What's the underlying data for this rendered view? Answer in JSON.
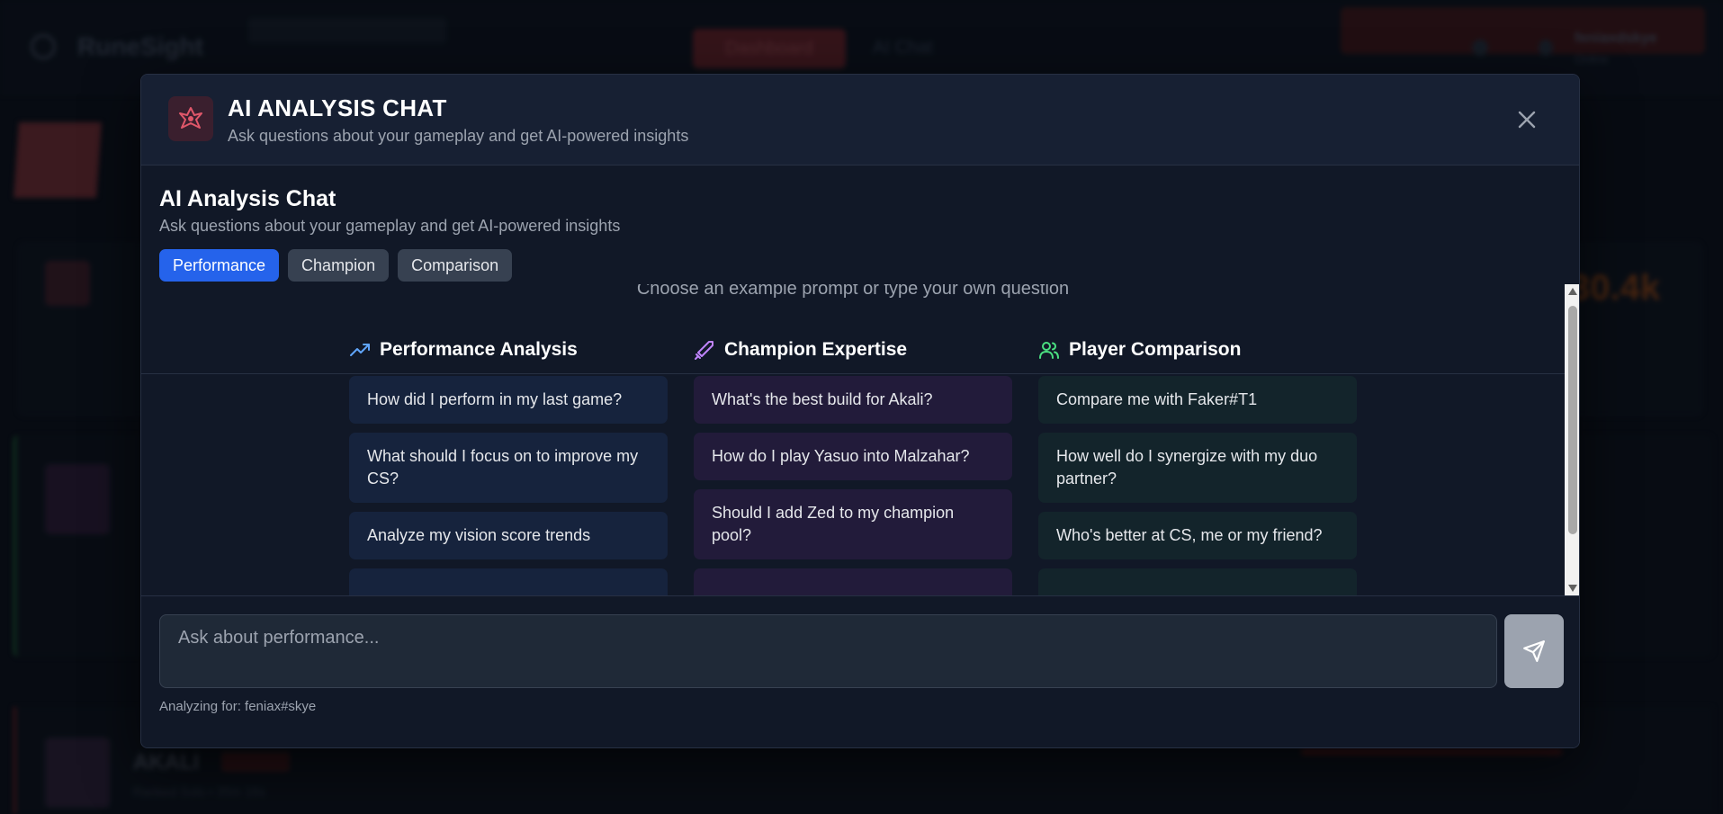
{
  "background_app": {
    "brand": "RuneSight",
    "nav": {
      "dashboard_label": "Dashboard",
      "ai_chat_label": "AI Chat"
    },
    "user": {
      "name": "feniaxdskye",
      "sub": "Online"
    },
    "featured_value": "30.4k",
    "match_champion": "AKALI",
    "match_meta": "Ranked Solo • 35m 16s"
  },
  "modal": {
    "title": "AI ANALYSIS CHAT",
    "subtitle": "Ask questions about your gameplay and get AI-powered insights",
    "section_title": "AI Analysis Chat",
    "section_subtitle": "Ask questions about your gameplay and get AI-powered insights",
    "tabs": [
      {
        "label": "Performance",
        "active": true
      },
      {
        "label": "Champion",
        "active": false
      },
      {
        "label": "Comparison",
        "active": false
      }
    ],
    "intro": "Choose an example prompt or type your own question",
    "columns": [
      {
        "title": "Performance Analysis",
        "icon": "trending-up-icon",
        "color": "#60a5fa",
        "prompts": [
          "How did I perform in my last game?",
          "What should I focus on to improve my CS?",
          "Analyze my vision score trends",
          ""
        ]
      },
      {
        "title": "Champion Expertise",
        "icon": "sword-icon",
        "color": "#c084fc",
        "prompts": [
          "What's the best build for Akali?",
          "How do I play Yasuo into Malzahar?",
          "Should I add Zed to my champion pool?",
          ""
        ]
      },
      {
        "title": "Player Comparison",
        "icon": "users-icon",
        "color": "#4ade80",
        "prompts": [
          "Compare me with Faker#T1",
          "How well do I synergize with my duo partner?",
          "Who's better at CS, me or my friend?",
          ""
        ]
      }
    ],
    "input": {
      "placeholder": "Ask about performance...",
      "value": ""
    },
    "analyzing_label": "Analyzing for: feniax#skye"
  },
  "colors": {
    "accent": "#2563eb",
    "modal_bg": "#111827",
    "header_bg": "#172033",
    "send_button": "#9ca3af"
  }
}
